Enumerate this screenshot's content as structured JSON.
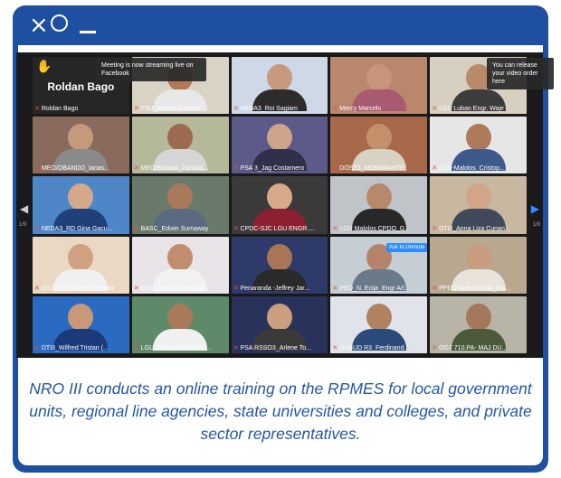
{
  "banner_left": "Meeting is now streaming live on Facebook",
  "banner_right": "You can release your video order here",
  "ask_to_unmute": "Ask to Unmute",
  "page_left": "1/9",
  "page_right": "1/9",
  "host": {
    "name": "Roldan Bago"
  },
  "participants": [
    {
      "name": "Roldan Bago",
      "bg": "#262626",
      "skin": "#c89a7a",
      "shirt": "#444"
    },
    {
      "name": "TSU_Marlon Gamido",
      "bg": "#d9d3c6",
      "skin": "#b07a58",
      "shirt": "#e8e8e8"
    },
    {
      "name": "NEDA3_Roi Sagiam",
      "bg": "#cfd8e6",
      "skin": "#c79a7e",
      "shirt": "#2c2c2c"
    },
    {
      "name": "Mercy Marcelo",
      "bg": "#b9876b",
      "skin": "#c9957a",
      "shirt": "#a85a70"
    },
    {
      "name": "LGU Lubao Engr. Waje",
      "bg": "#d7cfc0",
      "skin": "#b88a6a",
      "shirt": "#3c3c3c"
    },
    {
      "name": "MEO/OBANDO_Ianas...",
      "bg": "#8a6a5c",
      "skin": "#c59a7c",
      "shirt": "#8a8a8a"
    },
    {
      "name": "MEO/Bolotan_Zambal...",
      "bg": "#b6b89a",
      "skin": "#9b6a50",
      "shirt": "#d6d6d6"
    },
    {
      "name": "PSA 3_Jag Costamero",
      "bg": "#5c5a88",
      "skin": "#d0a48a",
      "shirt": "#30304a"
    },
    {
      "name": "DOST3_MGBARANTE",
      "bg": "#a8684a",
      "skin": "#c4906c",
      "shirt": "#d8d2c2"
    },
    {
      "name": "LGU-Malolos_Cristop...",
      "bg": "#e6e6e6",
      "skin": "#ad7a5a",
      "shirt": "#3d5a8a"
    },
    {
      "name": "NEDA3_RD Gina Gacu...",
      "bg": "#4f86c8",
      "skin": "#d4a88a",
      "shirt": "#20407a"
    },
    {
      "name": "BASC_Edwin Sumaway",
      "bg": "#6a7a6a",
      "skin": "#a8785a",
      "shirt": "#5a6a80"
    },
    {
      "name": "CPDC-SJC LGU ENGR....",
      "bg": "#3a3a3a",
      "skin": "#d6aa8a",
      "shirt": "#8a2030"
    },
    {
      "name": "LGU Malolos CPDO_G...",
      "bg": "#c0c4c8",
      "skin": "#b8886a",
      "shirt": "#28282a"
    },
    {
      "name": "DTI3_Anna Liza Cunan...",
      "bg": "#c8b8a0",
      "skin": "#d2a488",
      "shirt": "#404a5a"
    },
    {
      "name": "DILG R3 Charisse Pineda",
      "bg": "#ead8c4",
      "skin": "#d2a082",
      "shirt": "#f0f0f0"
    },
    {
      "name": "OCD_Harman Lebosa...",
      "bg": "#e8e4e8",
      "skin": "#c08e6e",
      "shirt": "#f2f2f2"
    },
    {
      "name": "Penaranda -Jeffrey Jar...",
      "bg": "#2e3a6a",
      "skin": "#a87656",
      "shirt": "#2a2a2a"
    },
    {
      "name": "PEO_N. Ecija_Engr Arl...",
      "bg": "#c5cdd5",
      "skin": "#b4846a",
      "shirt": "#6a7a8a"
    },
    {
      "name": "PPDO Nueva Ecija_R L...",
      "bg": "#b8a890",
      "skin": "#c89c7e",
      "shirt": "#e8e4dc"
    },
    {
      "name": "DTI3_Wilfred Tristan (...",
      "bg": "#2a6ac0",
      "skin": "#c89878",
      "shirt": "#1a3a7a"
    },
    {
      "name": "LGU-SAN LUIS, AURO...",
      "bg": "#5e8a6a",
      "skin": "#a87a5a",
      "shirt": "#f0f0f0"
    },
    {
      "name": "PSA RSSO3_Arlene To...",
      "bg": "#28325a",
      "skin": "#cc9e80",
      "shirt": "#3a3a3a"
    },
    {
      "name": "DHSUD R3_Ferdinand...",
      "bg": "#e0e4ea",
      "skin": "#b08262",
      "shirt": "#2a4a7a"
    },
    {
      "name": "OG7 710.PA- MAJ DU...",
      "bg": "#b8b4a8",
      "skin": "#a6785a",
      "shirt": "#4a5a3a"
    }
  ],
  "caption": "NRO III conducts an online training on the RPMES for local government units, regional line agencies, state universities and colleges, and private sector representatives.",
  "colors": {
    "frame": "#1f4fa0",
    "caption": "#2456a6",
    "accent": "#2d8cff"
  }
}
